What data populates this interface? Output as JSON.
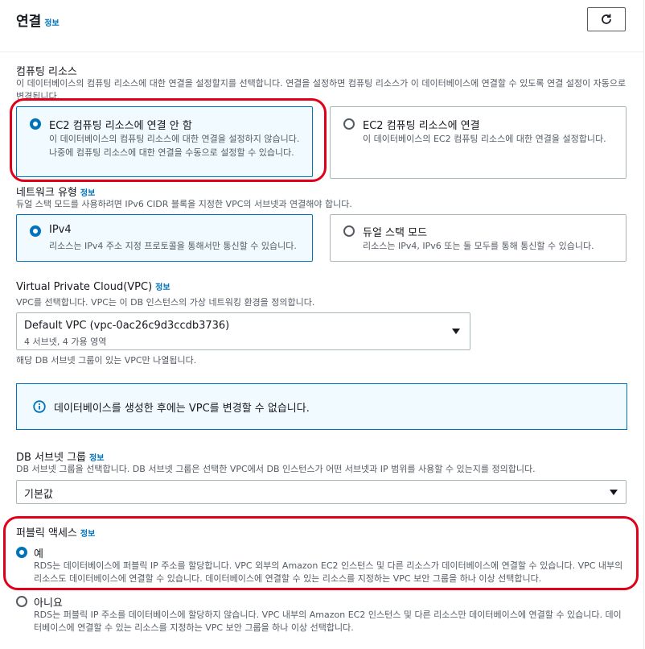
{
  "header": {
    "title": "연결",
    "info": "정보"
  },
  "compute": {
    "label": "컴퓨팅 리소스",
    "desc": "이 데이터베이스의 컴퓨팅 리소스에 대한 연결을 설정할지를 선택합니다. 연결을 설정하면 컴퓨팅 리소스가 이 데이터베이스에 연결할 수 있도록 연결 설정이 자동으로 변경됩니다.",
    "options": [
      {
        "title": "EC2 컴퓨팅 리소스에 연결 안 함",
        "desc": "이 데이터베이스의 컴퓨팅 리소스에 대한 연결을 설정하지 않습니다. 나중에 컴퓨팅 리소스에 대한 연결을 수동으로 설정할 수 있습니다.",
        "selected": true
      },
      {
        "title": "EC2 컴퓨팅 리소스에 연결",
        "desc": "이 데이터베이스의 EC2 컴퓨팅 리소스에 대한 연결을 설정합니다.",
        "selected": false
      }
    ]
  },
  "network": {
    "label": "네트워크 유형",
    "info": "정보",
    "desc": "듀얼 스택 모드를 사용하려면 IPv6 CIDR 블록을 지정한 VPC의 서브넷과 연결해야 합니다.",
    "options": [
      {
        "title": "IPv4",
        "desc": "리소스는 IPv4 주소 지정 프로토콜을 통해서만 통신할 수 있습니다.",
        "selected": true
      },
      {
        "title": "듀얼 스택 모드",
        "desc": "리소스는 IPv4, IPv6 또는 둘 모두를 통해 통신할 수 있습니다.",
        "selected": false
      }
    ]
  },
  "vpc": {
    "label": "Virtual Private Cloud(VPC)",
    "info": "정보",
    "desc": "VPC를 선택합니다. VPC는 이 DB 인스턴스의 가상 네트워킹 환경을 정의합니다.",
    "selected": "Default VPC (vpc-0ac26c9d3ccdb3736)",
    "selected_sub": "4 서브넷, 4 가용 영역",
    "hint": "해당 DB 서브넷 그룹이 있는 VPC만 나열됩니다.",
    "alert": "데이터베이스를 생성한 후에는 VPC를 변경할 수 없습니다."
  },
  "subnet": {
    "label": "DB 서브넷 그룹",
    "info": "정보",
    "desc": "DB 서브넷 그룹을 선택합니다. DB 서브넷 그룹은 선택한 VPC에서 DB 인스턴스가 어떤 서브넷과 IP 범위를 사용할 수 있는지를 정의합니다.",
    "selected": "기본값"
  },
  "public": {
    "label": "퍼블릭 액세스",
    "info": "정보",
    "options": [
      {
        "title": "예",
        "desc": "RDS는 데이터베이스에 퍼블릭 IP 주소를 할당합니다. VPC 외부의 Amazon EC2 인스턴스 및 다른 리소스가 데이터베이스에 연결할 수 있습니다. VPC 내부의 리소스도 데이터베이스에 연결할 수 있습니다. 데이터베이스에 연결할 수 있는 리소스를 지정하는 VPC 보안 그룹을 하나 이상 선택합니다.",
        "selected": true
      },
      {
        "title": "아니요",
        "desc": "RDS는 퍼블릭 IP 주소를 데이터베이스에 할당하지 않습니다. VPC 내부의 Amazon EC2 인스턴스 및 다른 리소스만 데이터베이스에 연결할 수 있습니다. 데이터베이스에 연결할 수 있는 리소스를 지정하는 VPC 보안 그룹을 하나 이상 선택합니다.",
        "selected": false
      }
    ]
  },
  "colors": {
    "accent": "#0073bb",
    "highlight": "#e0001a"
  }
}
